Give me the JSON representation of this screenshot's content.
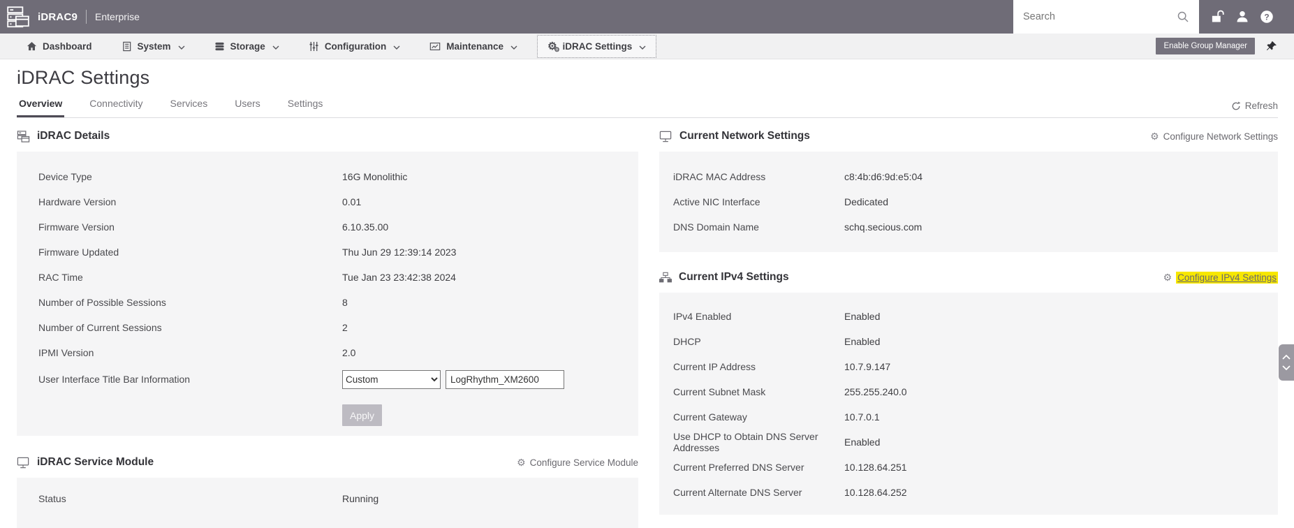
{
  "header": {
    "product": "iDRAC9",
    "edition": "Enterprise",
    "search_placeholder": "Search"
  },
  "nav": {
    "items": [
      {
        "label": "Dashboard"
      },
      {
        "label": "System"
      },
      {
        "label": "Storage"
      },
      {
        "label": "Configuration"
      },
      {
        "label": "Maintenance"
      },
      {
        "label": "iDRAC Settings"
      }
    ],
    "enable_group_manager": "Enable Group Manager"
  },
  "page": {
    "title": "iDRAC Settings",
    "tabs": [
      "Overview",
      "Connectivity",
      "Services",
      "Users",
      "Settings"
    ],
    "active_tab": "Overview",
    "refresh_label": "Refresh"
  },
  "sections": {
    "idrac_details": {
      "title": "iDRAC Details",
      "rows": [
        {
          "label": "Device Type",
          "value": "16G Monolithic"
        },
        {
          "label": "Hardware Version",
          "value": "0.01"
        },
        {
          "label": "Firmware Version",
          "value": "6.10.35.00"
        },
        {
          "label": "Firmware Updated",
          "value": "Thu Jun 29 12:39:14 2023"
        },
        {
          "label": "RAC Time",
          "value": "Tue Jan 23 23:42:38 2024"
        },
        {
          "label": "Number of Possible Sessions",
          "value": "8"
        },
        {
          "label": "Number of Current Sessions",
          "value": "2"
        },
        {
          "label": "IPMI Version",
          "value": "2.0"
        }
      ],
      "title_bar_row": {
        "label": "User Interface Title Bar Information",
        "select_value": "Custom",
        "input_value": "LogRhythm_XM2600"
      },
      "apply_label": "Apply"
    },
    "service_module": {
      "title": "iDRAC Service Module",
      "configure_label": "Configure Service Module",
      "rows": [
        {
          "label": "Status",
          "value": "Running"
        }
      ]
    },
    "network_settings": {
      "title": "Current Network Settings",
      "configure_label": "Configure Network Settings",
      "rows": [
        {
          "label": "iDRAC MAC Address",
          "value": "c8:4b:d6:9d:e5:04"
        },
        {
          "label": "Active NIC Interface",
          "value": "Dedicated"
        },
        {
          "label": "DNS Domain Name",
          "value": "schq.secious.com"
        }
      ]
    },
    "ipv4_settings": {
      "title": "Current IPv4 Settings",
      "configure_label": "Configure IPv4 Settings",
      "highlighted": true,
      "rows": [
        {
          "label": "IPv4 Enabled",
          "value": "Enabled"
        },
        {
          "label": "DHCP",
          "value": "Enabled"
        },
        {
          "label": "Current IP Address",
          "value": "10.7.9.147"
        },
        {
          "label": "Current Subnet Mask",
          "value": "255.255.240.0"
        },
        {
          "label": "Current Gateway",
          "value": "10.7.0.1"
        },
        {
          "label": "Use DHCP to Obtain DNS Server Addresses",
          "value": "Enabled"
        },
        {
          "label": "Current Preferred DNS Server",
          "value": "10.128.64.251"
        },
        {
          "label": "Current Alternate DNS Server",
          "value": "10.128.64.252"
        }
      ]
    }
  },
  "colors": {
    "header_bg": "#6f6c77",
    "navbar_bg": "#f1f1f2",
    "panel_bg": "#f5f5f6",
    "highlight": "#f7e700",
    "button_bg": "#75727d",
    "tab_underline": "#4e4b55",
    "apply_disabled": "#bdbbc2",
    "link": "#6a696f",
    "text_dark": "#3e3e42",
    "text_label": "#4a4a4e"
  }
}
